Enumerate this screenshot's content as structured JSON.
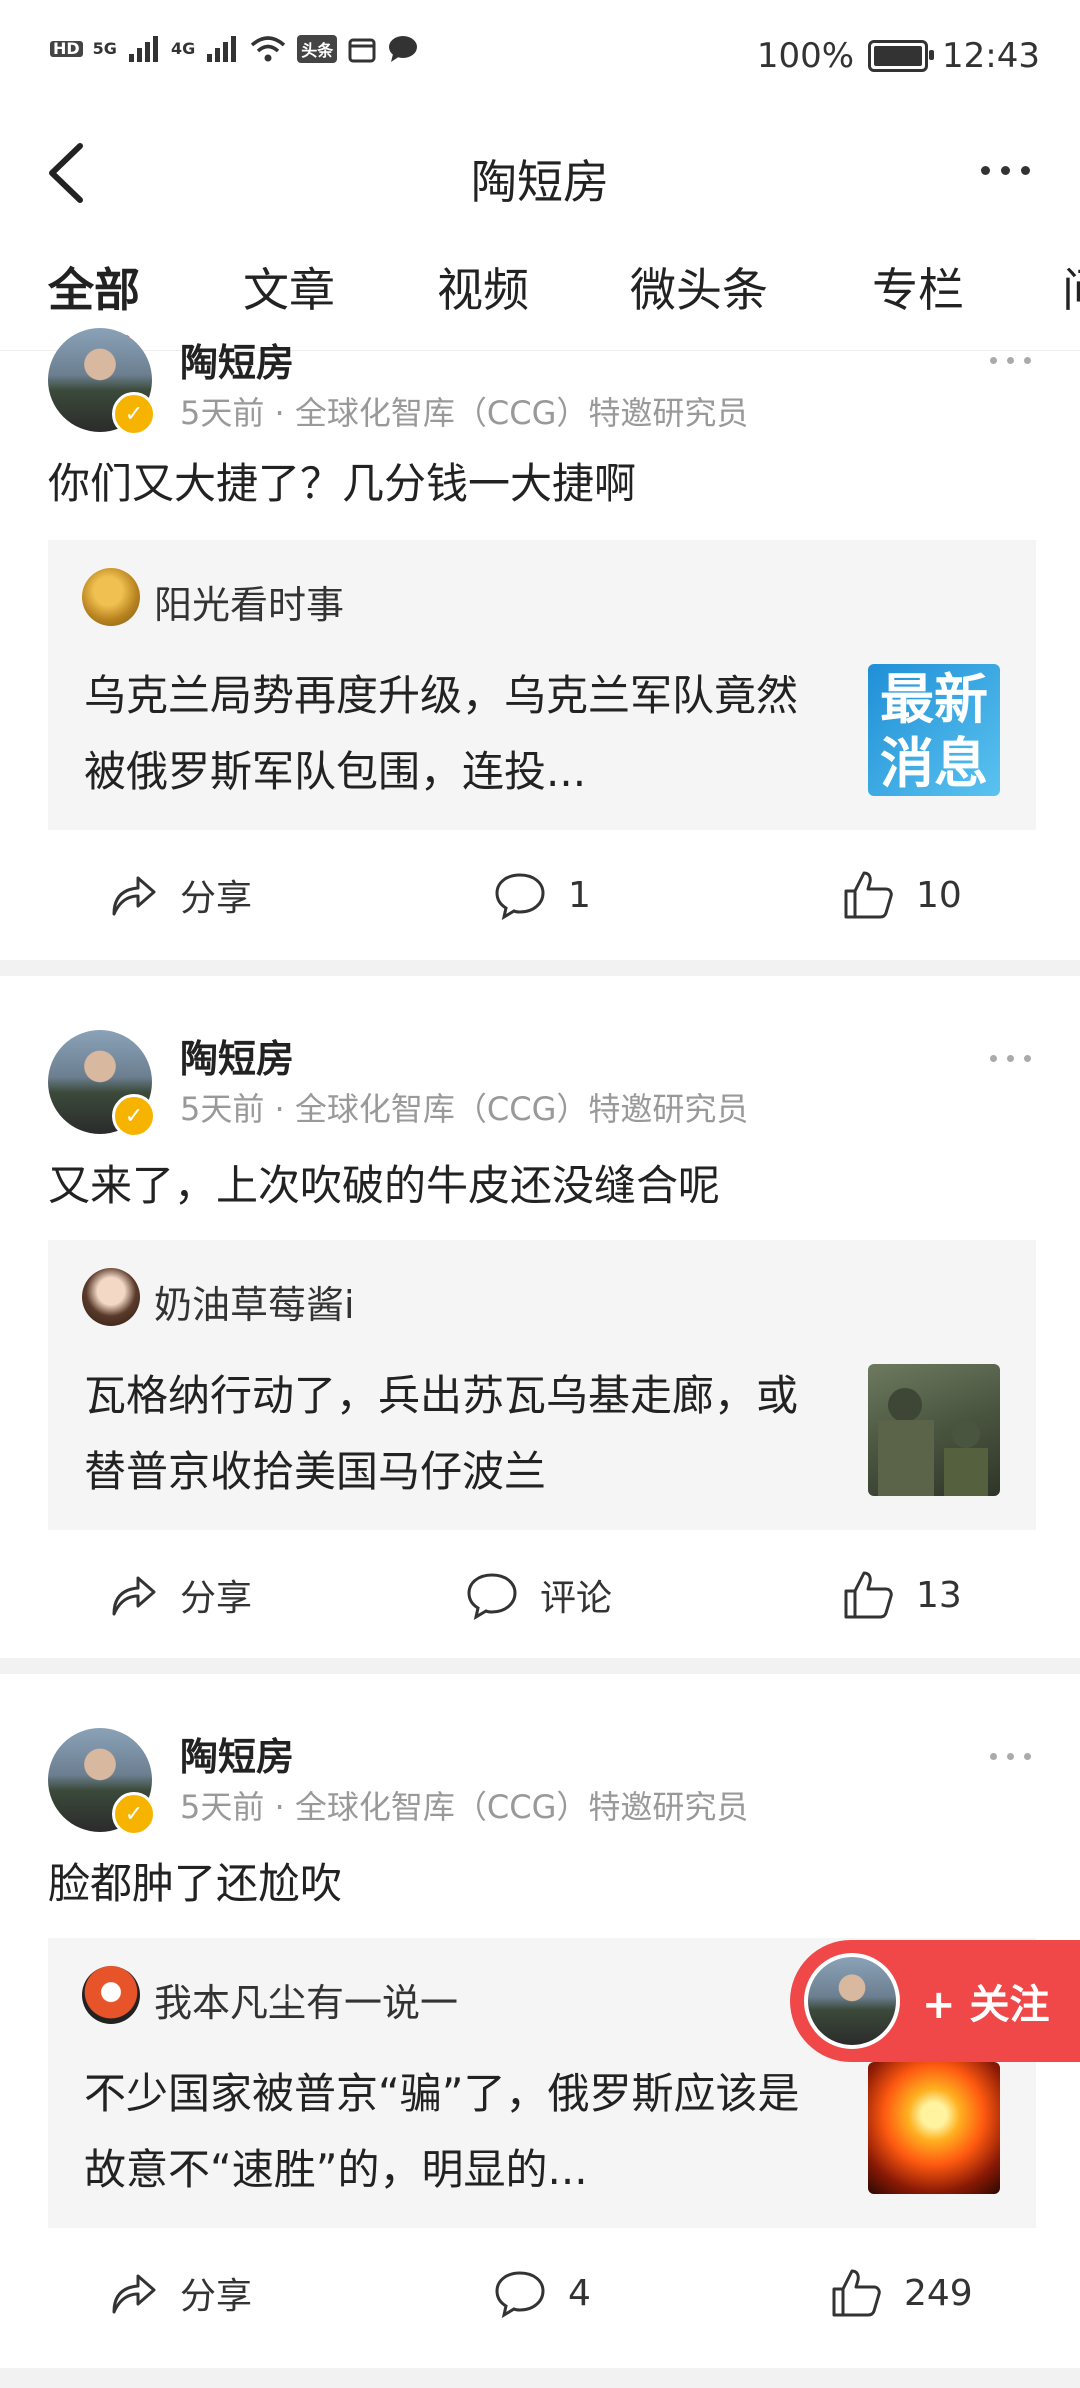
{
  "status_bar": {
    "network_labels": [
      "HD",
      "5G",
      "4G"
    ],
    "app_badge": "头条",
    "battery": "100%",
    "time": "12:43"
  },
  "header": {
    "title": "陶短房"
  },
  "tabs": [
    {
      "label": "全部",
      "active": true
    },
    {
      "label": "文章"
    },
    {
      "label": "视频"
    },
    {
      "label": "微头条"
    },
    {
      "label": "专栏"
    },
    {
      "label": "问"
    }
  ],
  "posts": [
    {
      "author": "陶短房",
      "meta": "5天前 · 全球化智库（CCG）特邀研究员",
      "text": "你们又大捷了？几分钱一大捷啊",
      "quote": {
        "author": "阳光看时事",
        "text": "乌克兰局势再度升级，乌克兰军队竟然被俄罗斯军队包围，连投...",
        "thumb_text_1": "最新",
        "thumb_text_2": "消息"
      },
      "share_label": "分享",
      "comment_label": "1",
      "like_count": "10"
    },
    {
      "author": "陶短房",
      "meta": "5天前 · 全球化智库（CCG）特邀研究员",
      "text": "又来了，上次吹破的牛皮还没缝合呢",
      "quote": {
        "author": "奶油草莓酱i",
        "text": "瓦格纳行动了，兵出苏瓦乌基走廊，或替普京收拾美国马仔波兰"
      },
      "share_label": "分享",
      "comment_label": "评论",
      "like_count": "13"
    },
    {
      "author": "陶短房",
      "meta": "5天前 · 全球化智库（CCG）特邀研究员",
      "text": "脸都肿了还尬吹",
      "quote": {
        "author": "我本凡尘有一说一",
        "text": "不少国家被普京“骗”了，俄罗斯应该是故意不“速胜”的，明显的..."
      },
      "share_label": "分享",
      "comment_label": "4",
      "like_count": "249"
    }
  ],
  "follow_button": {
    "label": "+ 关注"
  },
  "colors": {
    "accent": "#e64545",
    "fab": "#f04848",
    "card_bg": "#f5f5f5",
    "meta_text": "#999999"
  }
}
